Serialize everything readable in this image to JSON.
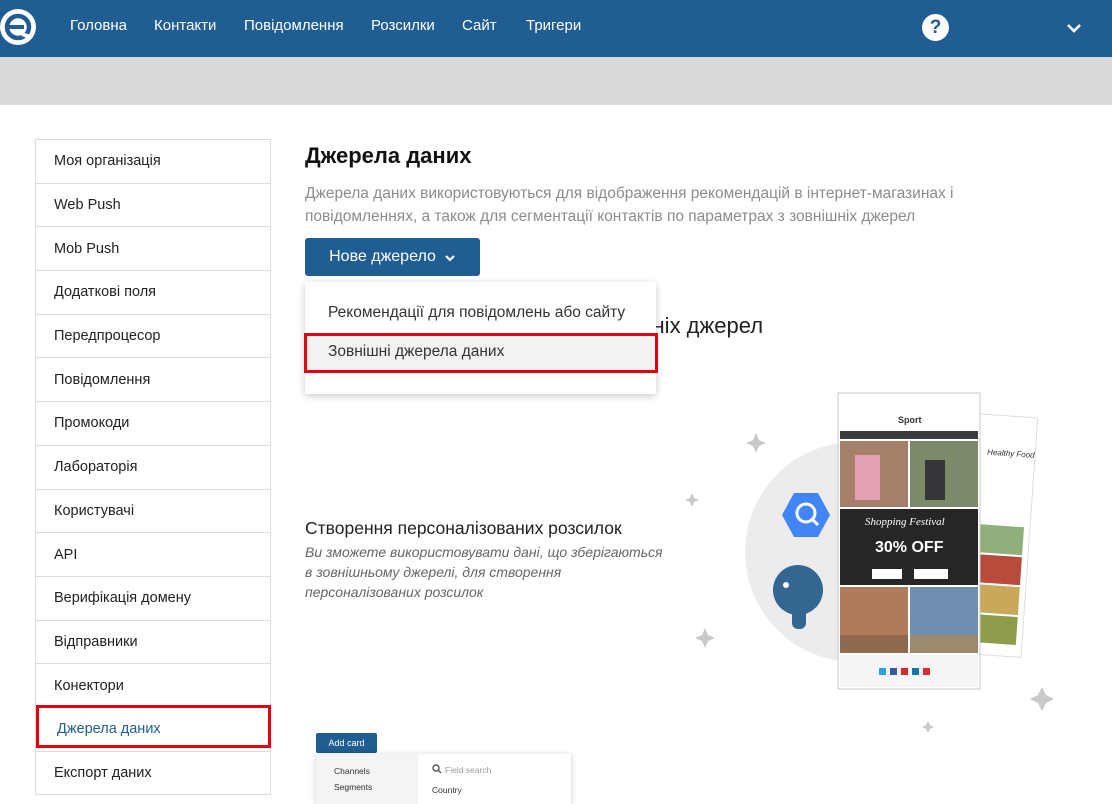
{
  "nav": {
    "items": [
      "Головна",
      "Контакти",
      "Повідомлення",
      "Розсилки",
      "Сайт",
      "Тригери"
    ],
    "help_symbol": "?"
  },
  "sidebar": {
    "items": [
      {
        "label": "Моя організація"
      },
      {
        "label": "Web Push"
      },
      {
        "label": "Mob Push"
      },
      {
        "label": "Додаткові поля"
      },
      {
        "label": "Передпроцесор"
      },
      {
        "label": "Повідомлення"
      },
      {
        "label": "Промокоди"
      },
      {
        "label": "Лабораторія"
      },
      {
        "label": "Користувачі"
      },
      {
        "label": "API"
      },
      {
        "label": "Верифікація домену"
      },
      {
        "label": "Відправники"
      },
      {
        "label": "Конектори"
      },
      {
        "label": "Джерела даних"
      },
      {
        "label": "Експорт даних"
      }
    ],
    "active_label": "Джерела даних"
  },
  "main": {
    "title": "Джерела даних",
    "description": "Джерела даних використовуються для відображення рекомендацій в інтернет-магазинах і повідомленнях, а також для сегментації контактів по параметрах з зовнішніх джерел",
    "new_button_label": "Нове джерело",
    "partial_heading": "ішніх джерел",
    "feature": {
      "title": "Створення персоналізованих розсилок",
      "description": "Ви зможете використовувати дані, що зберігаються в зовнішньому джерелі, для створення персоналізованих розсилок"
    }
  },
  "dropdown": {
    "items": [
      "Рекомендації для повідомлень або сайту",
      "Зовнішні джерела даних"
    ],
    "highlighted_index": 1
  },
  "illustration": {
    "brand": "Sport",
    "headline": "Shopping Festival",
    "offer": "30% OFF",
    "side_text": "Healthy Food"
  },
  "preview": {
    "add_card": "Add card",
    "left_items": [
      "Channels",
      "Segments"
    ],
    "search_placeholder": "Field search",
    "field": "Country"
  },
  "colors": {
    "brand": "#1f5d92",
    "highlight": "#e3000f"
  }
}
